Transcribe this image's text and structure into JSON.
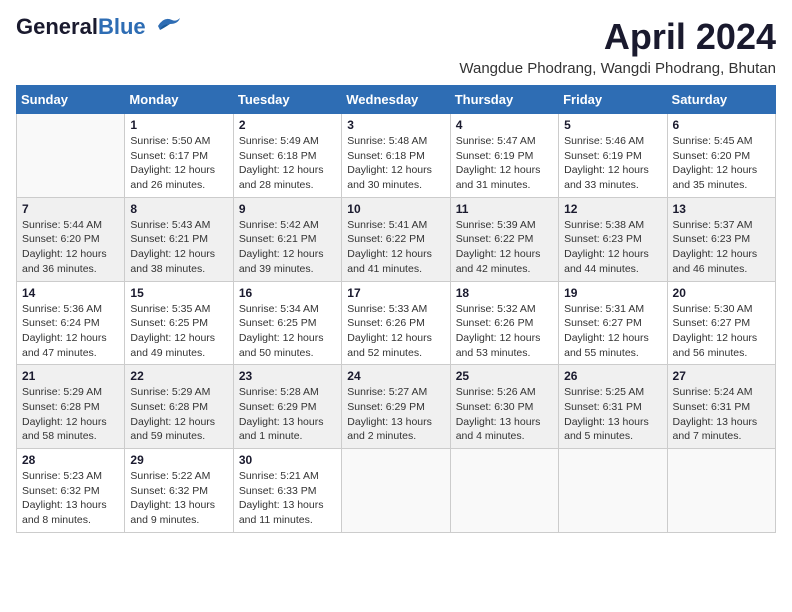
{
  "logo": {
    "general": "General",
    "blue": "Blue"
  },
  "title": "April 2024",
  "subtitle": "Wangdue Phodrang, Wangdi Phodrang, Bhutan",
  "days": [
    "Sunday",
    "Monday",
    "Tuesday",
    "Wednesday",
    "Thursday",
    "Friday",
    "Saturday"
  ],
  "weeks": [
    [
      {
        "day": "",
        "info": ""
      },
      {
        "day": "1",
        "info": "Sunrise: 5:50 AM\nSunset: 6:17 PM\nDaylight: 12 hours\nand 26 minutes."
      },
      {
        "day": "2",
        "info": "Sunrise: 5:49 AM\nSunset: 6:18 PM\nDaylight: 12 hours\nand 28 minutes."
      },
      {
        "day": "3",
        "info": "Sunrise: 5:48 AM\nSunset: 6:18 PM\nDaylight: 12 hours\nand 30 minutes."
      },
      {
        "day": "4",
        "info": "Sunrise: 5:47 AM\nSunset: 6:19 PM\nDaylight: 12 hours\nand 31 minutes."
      },
      {
        "day": "5",
        "info": "Sunrise: 5:46 AM\nSunset: 6:19 PM\nDaylight: 12 hours\nand 33 minutes."
      },
      {
        "day": "6",
        "info": "Sunrise: 5:45 AM\nSunset: 6:20 PM\nDaylight: 12 hours\nand 35 minutes."
      }
    ],
    [
      {
        "day": "7",
        "info": "Sunrise: 5:44 AM\nSunset: 6:20 PM\nDaylight: 12 hours\nand 36 minutes."
      },
      {
        "day": "8",
        "info": "Sunrise: 5:43 AM\nSunset: 6:21 PM\nDaylight: 12 hours\nand 38 minutes."
      },
      {
        "day": "9",
        "info": "Sunrise: 5:42 AM\nSunset: 6:21 PM\nDaylight: 12 hours\nand 39 minutes."
      },
      {
        "day": "10",
        "info": "Sunrise: 5:41 AM\nSunset: 6:22 PM\nDaylight: 12 hours\nand 41 minutes."
      },
      {
        "day": "11",
        "info": "Sunrise: 5:39 AM\nSunset: 6:22 PM\nDaylight: 12 hours\nand 42 minutes."
      },
      {
        "day": "12",
        "info": "Sunrise: 5:38 AM\nSunset: 6:23 PM\nDaylight: 12 hours\nand 44 minutes."
      },
      {
        "day": "13",
        "info": "Sunrise: 5:37 AM\nSunset: 6:23 PM\nDaylight: 12 hours\nand 46 minutes."
      }
    ],
    [
      {
        "day": "14",
        "info": "Sunrise: 5:36 AM\nSunset: 6:24 PM\nDaylight: 12 hours\nand 47 minutes."
      },
      {
        "day": "15",
        "info": "Sunrise: 5:35 AM\nSunset: 6:25 PM\nDaylight: 12 hours\nand 49 minutes."
      },
      {
        "day": "16",
        "info": "Sunrise: 5:34 AM\nSunset: 6:25 PM\nDaylight: 12 hours\nand 50 minutes."
      },
      {
        "day": "17",
        "info": "Sunrise: 5:33 AM\nSunset: 6:26 PM\nDaylight: 12 hours\nand 52 minutes."
      },
      {
        "day": "18",
        "info": "Sunrise: 5:32 AM\nSunset: 6:26 PM\nDaylight: 12 hours\nand 53 minutes."
      },
      {
        "day": "19",
        "info": "Sunrise: 5:31 AM\nSunset: 6:27 PM\nDaylight: 12 hours\nand 55 minutes."
      },
      {
        "day": "20",
        "info": "Sunrise: 5:30 AM\nSunset: 6:27 PM\nDaylight: 12 hours\nand 56 minutes."
      }
    ],
    [
      {
        "day": "21",
        "info": "Sunrise: 5:29 AM\nSunset: 6:28 PM\nDaylight: 12 hours\nand 58 minutes."
      },
      {
        "day": "22",
        "info": "Sunrise: 5:29 AM\nSunset: 6:28 PM\nDaylight: 12 hours\nand 59 minutes."
      },
      {
        "day": "23",
        "info": "Sunrise: 5:28 AM\nSunset: 6:29 PM\nDaylight: 13 hours\nand 1 minute."
      },
      {
        "day": "24",
        "info": "Sunrise: 5:27 AM\nSunset: 6:29 PM\nDaylight: 13 hours\nand 2 minutes."
      },
      {
        "day": "25",
        "info": "Sunrise: 5:26 AM\nSunset: 6:30 PM\nDaylight: 13 hours\nand 4 minutes."
      },
      {
        "day": "26",
        "info": "Sunrise: 5:25 AM\nSunset: 6:31 PM\nDaylight: 13 hours\nand 5 minutes."
      },
      {
        "day": "27",
        "info": "Sunrise: 5:24 AM\nSunset: 6:31 PM\nDaylight: 13 hours\nand 7 minutes."
      }
    ],
    [
      {
        "day": "28",
        "info": "Sunrise: 5:23 AM\nSunset: 6:32 PM\nDaylight: 13 hours\nand 8 minutes."
      },
      {
        "day": "29",
        "info": "Sunrise: 5:22 AM\nSunset: 6:32 PM\nDaylight: 13 hours\nand 9 minutes."
      },
      {
        "day": "30",
        "info": "Sunrise: 5:21 AM\nSunset: 6:33 PM\nDaylight: 13 hours\nand 11 minutes."
      },
      {
        "day": "",
        "info": ""
      },
      {
        "day": "",
        "info": ""
      },
      {
        "day": "",
        "info": ""
      },
      {
        "day": "",
        "info": ""
      }
    ]
  ]
}
